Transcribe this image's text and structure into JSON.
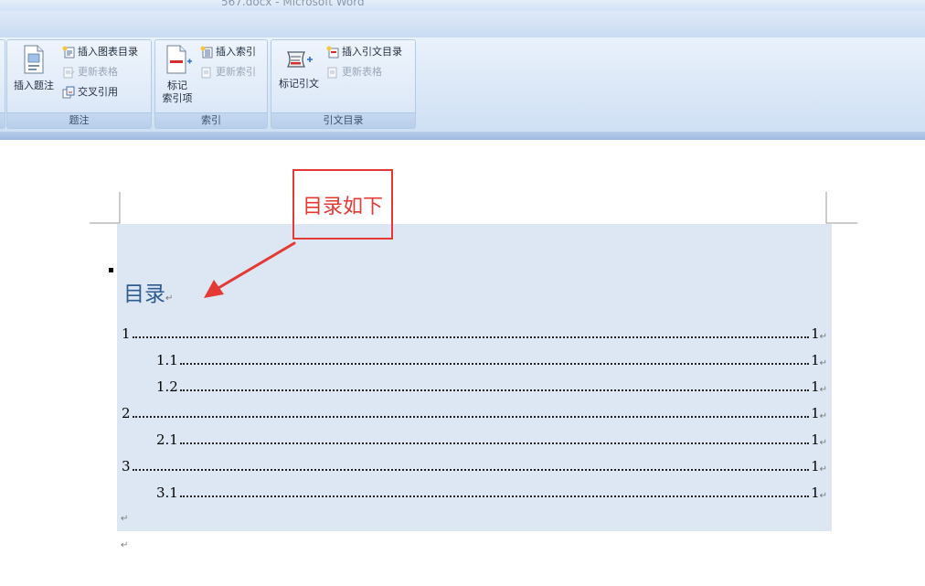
{
  "window": {
    "title": "567.docx - Microsoft Word"
  },
  "ribbon": {
    "groups": [
      {
        "label": "题注",
        "big_button": "插入题注",
        "small_buttons": [
          "插入图表目录",
          "更新表格",
          "交叉引用"
        ]
      },
      {
        "label": "索引",
        "big_button_line1": "标记",
        "big_button_line2": "索引项",
        "small_buttons": [
          "插入索引",
          "更新索引"
        ]
      },
      {
        "label": "引文目录",
        "big_button": "标记引文",
        "small_buttons": [
          "插入引文目录",
          "更新表格"
        ]
      }
    ]
  },
  "annotation": {
    "text": "目录如下",
    "color": "#e53935"
  },
  "document": {
    "toc_heading": "目录",
    "paragraph_mark": "↵",
    "toc_entries": [
      {
        "num": "1",
        "page": "1"
      },
      {
        "num": "1.1",
        "page": "1"
      },
      {
        "num": "1.2",
        "page": "1"
      },
      {
        "num": "2",
        "page": "1"
      },
      {
        "num": "2.1",
        "page": "1"
      },
      {
        "num": "3",
        "page": "1"
      },
      {
        "num": "3.1",
        "page": "1"
      }
    ]
  },
  "icons": {
    "caption": "insert-caption-icon",
    "figure_toc": "insert-table-of-figures-icon",
    "update_table": "update-table-icon",
    "cross_ref": "cross-reference-icon",
    "mark_entry": "mark-index-entry-icon",
    "insert_index": "insert-index-icon",
    "update_index": "update-index-icon",
    "mark_citation": "mark-citation-icon",
    "insert_toa": "insert-table-of-authorities-icon"
  },
  "colors": {
    "accent": "#2e5b90",
    "toc_background": "#dce7f3",
    "ribbon": "#dbe8f7"
  }
}
